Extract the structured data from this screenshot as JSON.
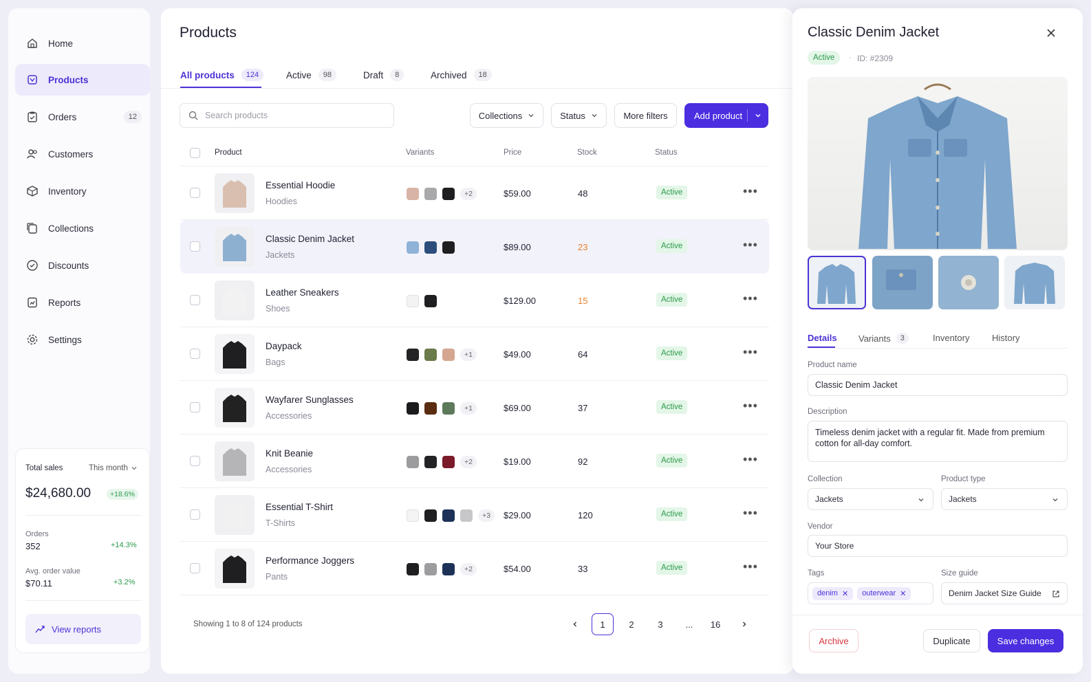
{
  "sidebar": {
    "items": [
      {
        "label": "Home",
        "icon": "home-icon"
      },
      {
        "label": "Products",
        "icon": "tag-icon",
        "active": true
      },
      {
        "label": "Orders",
        "icon": "clipboard-icon",
        "badge": "12"
      },
      {
        "label": "Customers",
        "icon": "users-icon"
      },
      {
        "label": "Inventory",
        "icon": "box-icon"
      },
      {
        "label": "Collections",
        "icon": "collections-icon"
      },
      {
        "label": "Discounts",
        "icon": "discount-icon"
      },
      {
        "label": "Reports",
        "icon": "chart-icon"
      },
      {
        "label": "Settings",
        "icon": "gear-icon"
      }
    ],
    "sales": {
      "title": "Total sales",
      "period": "This month",
      "total": "$24,680.00",
      "total_change": "+18.6%",
      "orders_label": "Orders",
      "orders_value": "352",
      "orders_change": "+14.3%",
      "aov_label": "Avg. order value",
      "aov_value": "$70.11",
      "aov_change": "+3.2%",
      "view_reports": "View reports"
    }
  },
  "main": {
    "title": "Products",
    "tabs": [
      {
        "label": "All products",
        "count": "124",
        "active": true
      },
      {
        "label": "Active",
        "count": "98"
      },
      {
        "label": "Draft",
        "count": "8"
      },
      {
        "label": "Archived",
        "count": "18"
      }
    ],
    "search_placeholder": "Search products",
    "filters": {
      "collections": "Collections",
      "status": "Status",
      "more": "More filters"
    },
    "add_product": "Add product",
    "columns": {
      "product": "Product",
      "variants": "Variants",
      "price": "Price",
      "stock": "Stock",
      "status": "Status"
    },
    "rows": [
      {
        "name": "Essential Hoodie",
        "category": "Hoodies",
        "swatches": [
          "#d8b4a6",
          "#a9a9ab",
          "#1f1f22"
        ],
        "more": "+2",
        "price": "$59.00",
        "stock": "48",
        "low": false,
        "status": "Active",
        "thumb": "#d9bfb0"
      },
      {
        "name": "Classic Denim Jacket",
        "category": "Jackets",
        "swatches": [
          "#8fb3d6",
          "#2b4f7a",
          "#1f1f22"
        ],
        "more": "",
        "price": "$89.00",
        "stock": "23",
        "low": true,
        "status": "Active",
        "thumb": "#8db0d0",
        "selected": true
      },
      {
        "name": "Leather Sneakers",
        "category": "Shoes",
        "swatches": [
          "#f3f3f3",
          "#1f1f22"
        ],
        "more": "",
        "price": "$129.00",
        "stock": "15",
        "low": true,
        "status": "Active",
        "thumb": "#f2f2f2"
      },
      {
        "name": "Daypack",
        "category": "Bags",
        "swatches": [
          "#232326",
          "#6b7a4a",
          "#d5a690"
        ],
        "more": "+1",
        "price": "$49.00",
        "stock": "64",
        "low": false,
        "status": "Active",
        "thumb": "#1f1f22"
      },
      {
        "name": "Wayfarer Sunglasses",
        "category": "Accessories",
        "swatches": [
          "#1b1b1d",
          "#5a2c12",
          "#5d7a5a"
        ],
        "more": "+1",
        "price": "$69.00",
        "stock": "37",
        "low": false,
        "status": "Active",
        "thumb": "#222"
      },
      {
        "name": "Knit Beanie",
        "category": "Accessories",
        "swatches": [
          "#9c9c9f",
          "#232326",
          "#7a1a2a"
        ],
        "more": "+2",
        "price": "$19.00",
        "stock": "92",
        "low": false,
        "status": "Active",
        "thumb": "#b5b5b8"
      },
      {
        "name": "Essential T-Shirt",
        "category": "T-Shirts",
        "swatches": [
          "#f4f4f4",
          "#1f1f22",
          "#1e3258",
          "#c7c7ca"
        ],
        "more": "+3",
        "price": "$29.00",
        "stock": "120",
        "low": false,
        "status": "Active",
        "thumb": "#f1f1f1"
      },
      {
        "name": "Performance Joggers",
        "category": "Pants",
        "swatches": [
          "#1f1f22",
          "#9d9da0",
          "#1e3258"
        ],
        "more": "+2",
        "price": "$54.00",
        "stock": "33",
        "low": false,
        "status": "Active",
        "thumb": "#1f1f22"
      }
    ],
    "showing": "Showing 1 to 8 of 124 products",
    "pages": [
      "1",
      "2",
      "3",
      "...",
      "16"
    ]
  },
  "panel": {
    "title": "Classic Denim Jacket",
    "status": "Active",
    "id": "ID: #2309",
    "tabs": [
      {
        "label": "Details",
        "active": true
      },
      {
        "label": "Variants",
        "count": "3"
      },
      {
        "label": "Inventory"
      },
      {
        "label": "History"
      }
    ],
    "product_name_label": "Product name",
    "product_name": "Classic Denim Jacket",
    "description_label": "Description",
    "description": "Timeless denim jacket with a regular fit. Made from premium cotton for all-day comfort.",
    "collection_label": "Collection",
    "collection": "Jackets",
    "type_label": "Product type",
    "type": "Jackets",
    "vendor_label": "Vendor",
    "vendor": "Your Store",
    "tags_label": "Tags",
    "tags": [
      "denim",
      "outerwear"
    ],
    "size_guide_label": "Size guide",
    "size_guide": "Denim Jacket Size Guide",
    "archive": "Archive",
    "duplicate": "Duplicate",
    "save": "Save changes"
  },
  "colors": {
    "accent": "#4b2ee0",
    "success": "#2b9a4a",
    "warning": "#e8832a",
    "danger": "#d9363e"
  }
}
